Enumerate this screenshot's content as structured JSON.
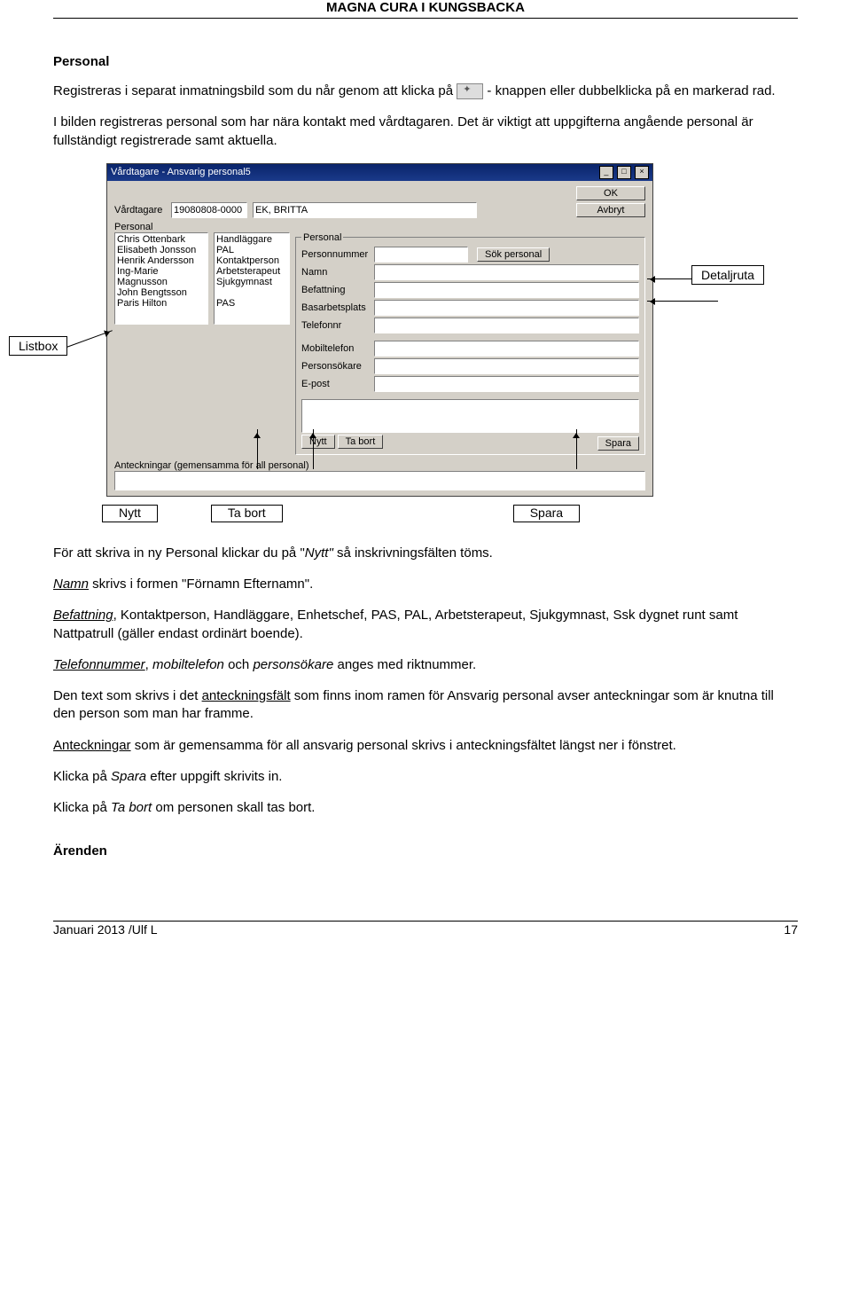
{
  "header": "MAGNA CURA I KUNGSBACKA",
  "section_title": "Personal",
  "intro1a": "Registreras i separat inmatningsbild som du når genom att klicka på ",
  "intro1b": " - knappen eller dubbelklicka på en markerad rad.",
  "intro2": "I bilden registreras personal som har nära kontakt med vårdtagaren. Det är viktigt att uppgifterna angående personal är fullständigt registrerade samt aktuella.",
  "annot_detaljruta": "Detaljruta",
  "annot_listbox": "Listbox",
  "annot_nytt": "Nytt",
  "annot_tabort": "Ta bort",
  "annot_spara": "Spara",
  "shot": {
    "title": "Vårdtagare - Ansvarig personal5",
    "lbl_vardtagare": "Vårdtagare",
    "val_pnr": "19080808-0000",
    "val_namn": "EK, BRITTA",
    "btn_ok": "OK",
    "btn_avbryt": "Avbryt",
    "lbl_personal_left": "Personal",
    "list_names": "Chris Ottenbark\nElisabeth Jonsson\nHenrik Andersson\nIng-Marie Magnusson\nJohn Bengtsson\nParis Hilton",
    "list_roles": "Handläggare\nPAL\nKontaktperson\nArbetsterapeut\nSjukgymnast\n\nPAS",
    "fs_legend": "Personal",
    "f_personnummer": "Personnummer",
    "f_namn": "Namn",
    "f_befattning": "Befattning",
    "f_basarbetsplats": "Basarbetsplats",
    "f_telefonnr": "Telefonnr",
    "f_mobiltelefon": "Mobiltelefon",
    "f_personsokare": "Personsökare",
    "f_epost": "E-post",
    "btn_sok": "Sök personal",
    "btn_nytt": "Nytt",
    "btn_tabort": "Ta bort",
    "btn_spara": "Spara",
    "notes": "Anteckningar (gemensamma för all personal)"
  },
  "body": {
    "p1a": "För att skriva in ny Personal klickar du på \"",
    "p1_em": "Nytt\"",
    "p1b": " så inskrivningsfälten töms.",
    "p2a": "Namn",
    "p2b": " skrivs i formen \"Förnamn Efternamn\".",
    "p3a": "Befattning",
    "p3b": ", Kontaktperson, Handläggare, Enhetschef, PAS, PAL, Arbetsterapeut, Sjukgymnast, Ssk dygnet runt samt Nattpatrull (gäller endast ordinärt boende).",
    "p4a": "Telefonnummer",
    "p4b": ", ",
    "p4c": "mobiltelefon",
    "p4d": " och ",
    "p4e": "personsökare",
    "p4f": " anges med riktnummer.",
    "p5a": "Den text som skrivs i det ",
    "p5u": "anteckningsfält",
    "p5b": " som finns inom ramen för Ansvarig personal avser anteckningar som är knutna till den person som man har framme.",
    "p6a": "Anteckningar",
    "p6b": " som är gemensamma för all ansvarig personal skrivs i anteckningsfältet längst ner i fönstret.",
    "p7a": "Klicka på ",
    "p7em": "Spara",
    "p7b": " efter uppgift skrivits in.",
    "p8a": "Klicka på ",
    "p8em": "Ta bort",
    "p8b": " om personen skall tas bort."
  },
  "h_arenden": "Ärenden",
  "footer_left": "Januari 2013 /Ulf L",
  "footer_right": "17"
}
